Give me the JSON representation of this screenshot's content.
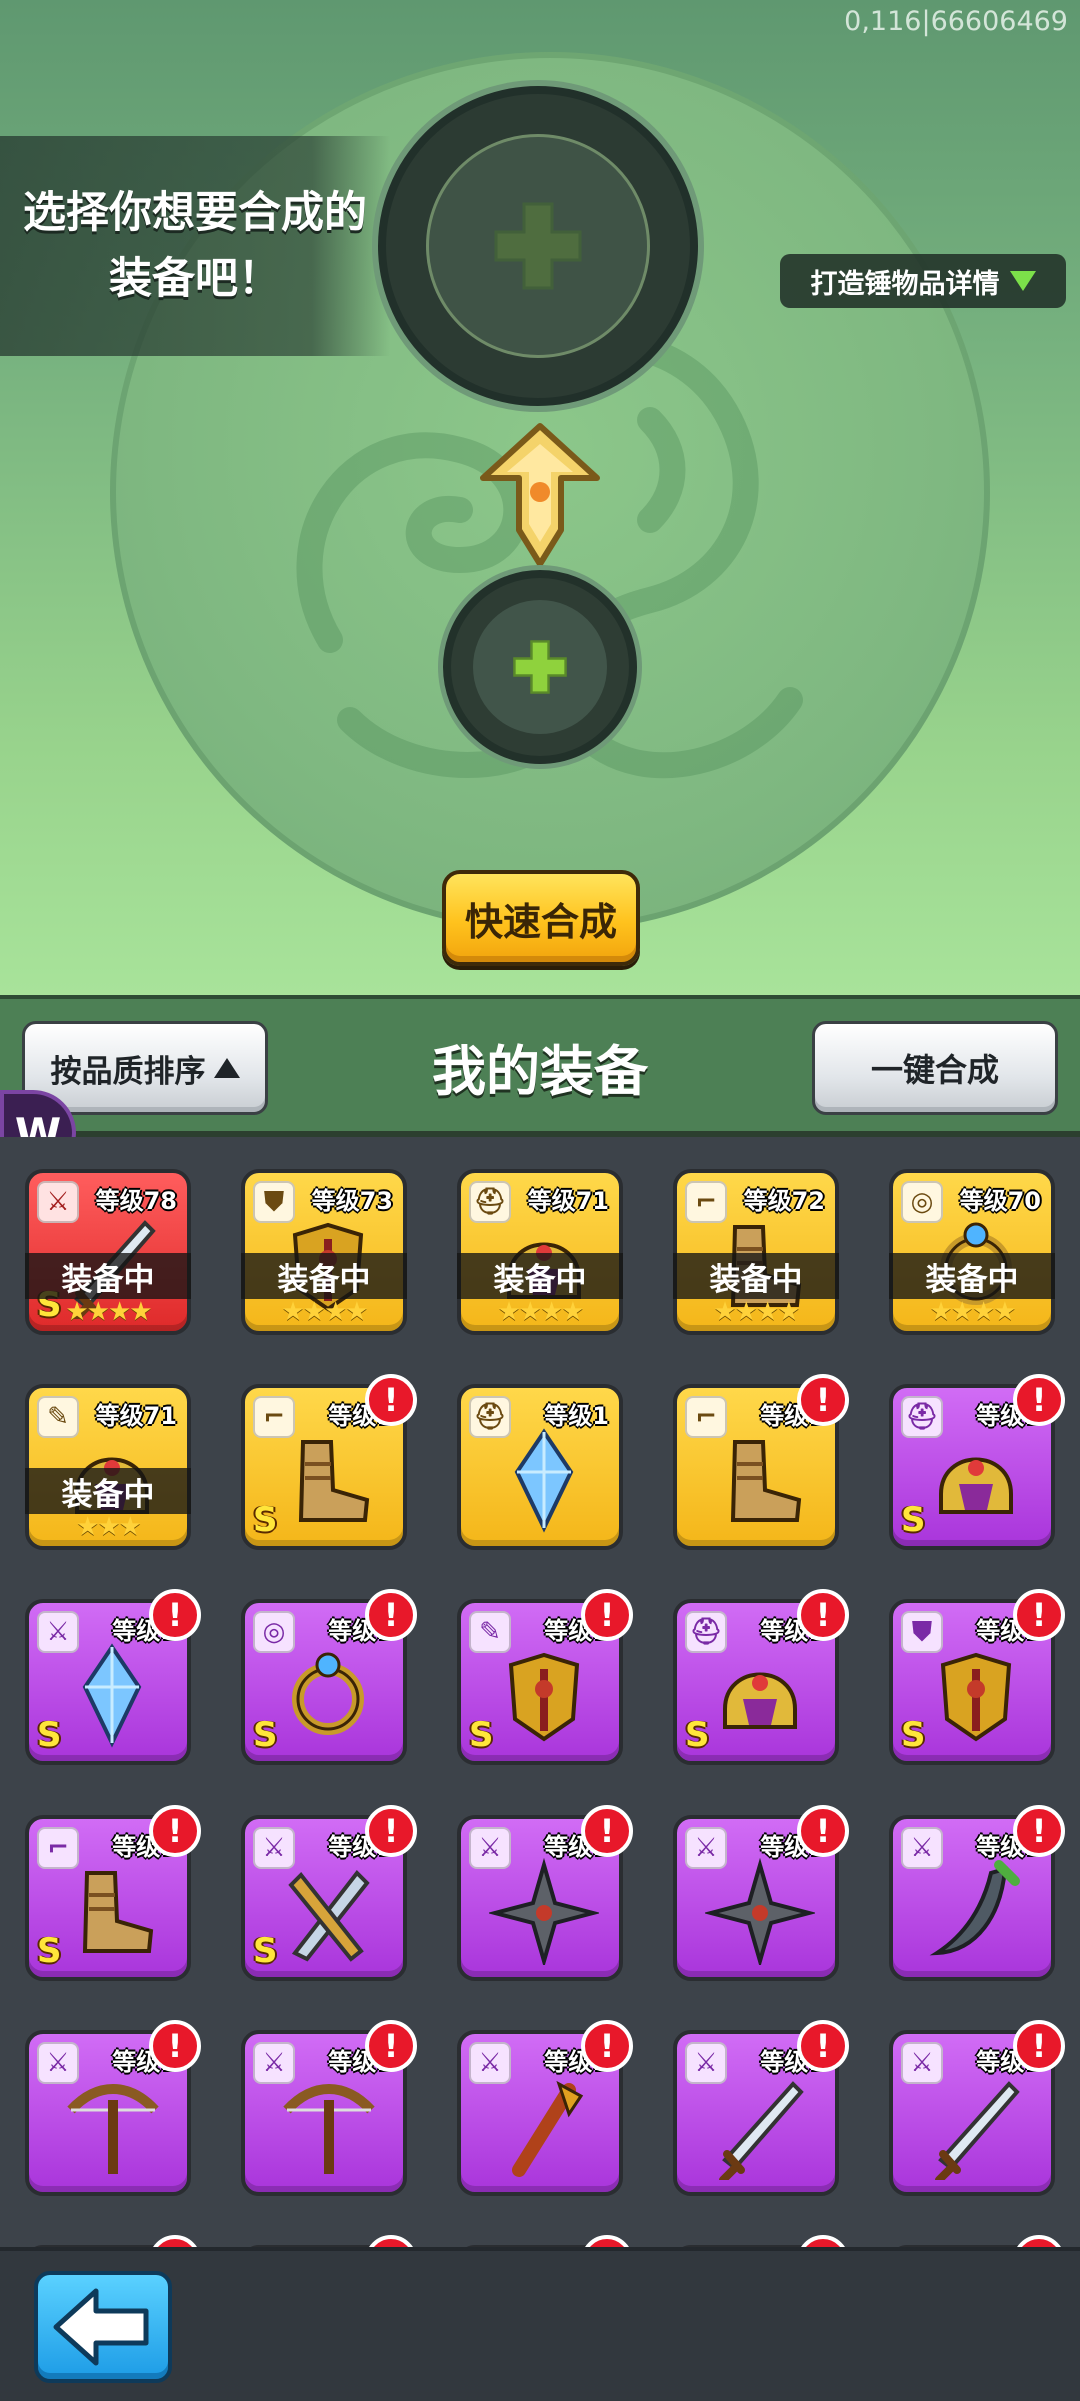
{
  "forge": {
    "serial": "0,116|66606469",
    "prompt": "选择你想要合成的\n装备吧！",
    "details_label": "打造锤物品详情",
    "quick_merge_label": "快速合成"
  },
  "header": {
    "sort_label": "按品质排序",
    "title": "我的装备",
    "one_click_label": "一键合成",
    "badge_letter": "W"
  },
  "inventory": [
    {
      "rarity": "red",
      "type": "weapon-icon",
      "type_glyph": "⚔",
      "level": "等级78",
      "equipped": "装备中",
      "stars": "★★★★",
      "grade": "S",
      "art": "blade"
    },
    {
      "rarity": "gold",
      "type": "armor-icon",
      "type_glyph": "⛊",
      "level": "等级73",
      "equipped": "装备中",
      "stars": "★★★★",
      "grade": "",
      "art": "armor"
    },
    {
      "rarity": "gold",
      "type": "helmet-icon",
      "type_glyph": "⛑",
      "level": "等级71",
      "equipped": "装备中",
      "stars": "★★★★",
      "grade": "",
      "art": "helmet"
    },
    {
      "rarity": "gold",
      "type": "boots-icon",
      "type_glyph": "⌐",
      "level": "等级72",
      "equipped": "装备中",
      "stars": "★★★★",
      "grade": "",
      "art": "boots"
    },
    {
      "rarity": "gold",
      "type": "ring-icon",
      "type_glyph": "◎",
      "level": "等级70",
      "equipped": "装备中",
      "stars": "★★★★",
      "grade": "",
      "art": "ring"
    },
    {
      "rarity": "gold",
      "type": "scroll-icon",
      "type_glyph": "✎",
      "level": "等级71",
      "equipped": "装备中",
      "stars": "★★★",
      "grade": "",
      "art": "helmet"
    },
    {
      "rarity": "gold",
      "type": "boots-icon",
      "type_glyph": "⌐",
      "level": "等级1",
      "equipped": "",
      "stars": "",
      "grade": "S",
      "art": "boots",
      "alert": "!"
    },
    {
      "rarity": "gold",
      "type": "helmet-icon",
      "type_glyph": "⛑",
      "level": "等级1",
      "equipped": "",
      "stars": "",
      "grade": "",
      "art": "crystal"
    },
    {
      "rarity": "gold",
      "type": "boots-icon",
      "type_glyph": "⌐",
      "level": "等级1",
      "equipped": "",
      "stars": "",
      "grade": "",
      "art": "boots",
      "alert": "!"
    },
    {
      "rarity": "purple",
      "type": "helmet-icon",
      "type_glyph": "⛑",
      "level": "等级1",
      "equipped": "",
      "stars": "",
      "grade": "S",
      "art": "helmet",
      "alert": "!"
    },
    {
      "rarity": "purple",
      "type": "weapon-icon",
      "type_glyph": "⚔",
      "level": "等级1",
      "equipped": "",
      "stars": "",
      "grade": "S",
      "art": "crystal",
      "alert": "!"
    },
    {
      "rarity": "purple",
      "type": "ring-icon",
      "type_glyph": "◎",
      "level": "等级1",
      "equipped": "",
      "stars": "",
      "grade": "S",
      "art": "ring",
      "alert": "!"
    },
    {
      "rarity": "purple",
      "type": "scroll-icon",
      "type_glyph": "✎",
      "level": "等级1",
      "equipped": "",
      "stars": "",
      "grade": "S",
      "art": "armor",
      "alert": "!"
    },
    {
      "rarity": "purple",
      "type": "helmet-icon",
      "type_glyph": "⛑",
      "level": "等级1",
      "equipped": "",
      "stars": "",
      "grade": "S",
      "art": "helmet",
      "alert": "!"
    },
    {
      "rarity": "purple",
      "type": "armor-icon",
      "type_glyph": "⛊",
      "level": "等级1",
      "equipped": "",
      "stars": "",
      "grade": "S",
      "art": "armor",
      "alert": "!"
    },
    {
      "rarity": "purple",
      "type": "boots-icon",
      "type_glyph": "⌐",
      "level": "等级1",
      "equipped": "",
      "stars": "",
      "grade": "S",
      "art": "boots",
      "alert": "!"
    },
    {
      "rarity": "purple",
      "type": "weapon-icon",
      "type_glyph": "⚔",
      "level": "等级1",
      "equipped": "",
      "stars": "",
      "grade": "S",
      "art": "sword",
      "alert": "!"
    },
    {
      "rarity": "purple",
      "type": "weapon-icon",
      "type_glyph": "⚔",
      "level": "等级1",
      "equipped": "",
      "stars": "",
      "grade": "",
      "art": "shuriken",
      "alert": "!"
    },
    {
      "rarity": "purple",
      "type": "weapon-icon",
      "type_glyph": "⚔",
      "level": "等级1",
      "equipped": "",
      "stars": "",
      "grade": "",
      "art": "shuriken",
      "alert": "!"
    },
    {
      "rarity": "purple",
      "type": "weapon-icon",
      "type_glyph": "⚔",
      "level": "等级1",
      "equipped": "",
      "stars": "",
      "grade": "",
      "art": "scimitar",
      "alert": "!"
    },
    {
      "rarity": "purple",
      "type": "weapon-icon",
      "type_glyph": "⚔",
      "level": "等级1",
      "equipped": "",
      "stars": "",
      "grade": "",
      "art": "crossbow",
      "alert": "!"
    },
    {
      "rarity": "purple",
      "type": "weapon-icon",
      "type_glyph": "⚔",
      "level": "等级1",
      "equipped": "",
      "stars": "",
      "grade": "",
      "art": "crossbow",
      "alert": "!"
    },
    {
      "rarity": "purple",
      "type": "weapon-icon",
      "type_glyph": "⚔",
      "level": "等级1",
      "equipped": "",
      "stars": "",
      "grade": "",
      "art": "staff",
      "alert": "!"
    },
    {
      "rarity": "purple",
      "type": "weapon-icon",
      "type_glyph": "⚔",
      "level": "等级1",
      "equipped": "",
      "stars": "",
      "grade": "",
      "art": "blade",
      "alert": "!"
    },
    {
      "rarity": "purple",
      "type": "weapon-icon",
      "type_glyph": "⚔",
      "level": "等级1",
      "equipped": "",
      "stars": "",
      "grade": "",
      "art": "blade",
      "alert": "!"
    }
  ],
  "colors": {
    "forge_bg": "#77b27f",
    "header_bg": "#4d8055",
    "grid_bg": "#3d434a",
    "gold_card": "#f4b619",
    "purple_card": "#a935db",
    "red_card": "#df2a2a",
    "alert": "#e8182a",
    "quick_button": "#ffc21d",
    "back_button": "#1d9ce6"
  },
  "icons": {
    "details_toggle": "triangle-down-icon",
    "sort_toggle": "triangle-up-icon",
    "back": "arrow-left-icon",
    "slot_add": "plus-icon"
  }
}
